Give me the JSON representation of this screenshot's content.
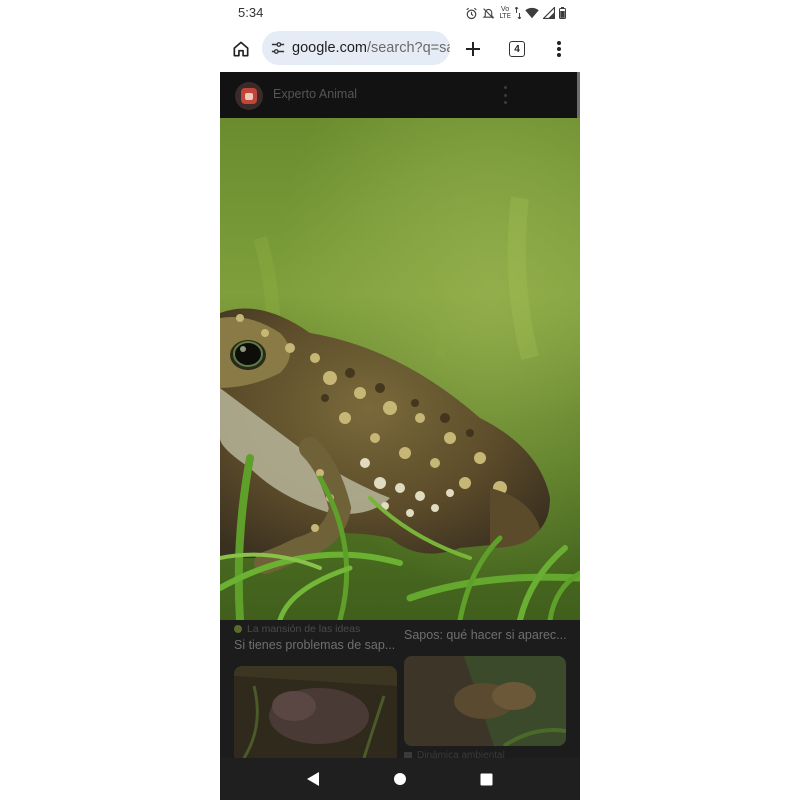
{
  "status_bar": {
    "time": "5:34",
    "volte_top": "Vo",
    "volte_bottom": "LTE"
  },
  "browser": {
    "url_host": "google.com",
    "url_path": "/search?q=sa",
    "tab_count": "4"
  },
  "viewer": {
    "site_name": "Experto Animal"
  },
  "results": {
    "card_a": {
      "source": "La mansión de las ideas",
      "title": "Si tienes problemas de sap..."
    },
    "card_b": {
      "title": "Sapos: qué hacer si aparec..."
    },
    "card_b_second_source": "Dinámica ambiental"
  },
  "colors": {
    "accent_url_box": "#e6ecf6",
    "viewer_background": "#1b1b1b",
    "nav_bar": "#1f1f1f"
  },
  "icons": {
    "home": "home-icon",
    "url_settings": "tune-icon",
    "new_tab": "plus-icon",
    "tabs": "tab-switcher-icon",
    "menu": "more-vert-icon",
    "back": "back-triangle-icon",
    "home_nav": "home-circle-icon",
    "recents": "recents-square-icon"
  }
}
